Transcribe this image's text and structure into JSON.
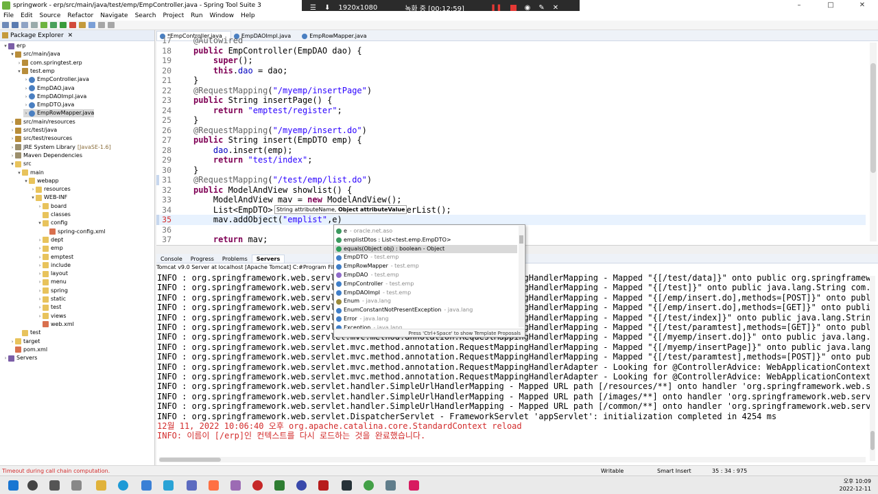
{
  "window": {
    "title": "springwork - erp/src/main/java/test/emp/EmpController.java - Spring Tool Suite 3",
    "controls": [
      "–",
      "□",
      "✕"
    ]
  },
  "recorder": {
    "resolution": "1920x1080",
    "status": "녹화 중 [00:12:59]"
  },
  "menu": [
    "File",
    "Edit",
    "Source",
    "Refactor",
    "Navigate",
    "Search",
    "Project",
    "Run",
    "Window",
    "Help"
  ],
  "package_explorer": {
    "tab": "Package Explorer",
    "items": [
      {
        "label": "erp",
        "indent": 0,
        "icon": "project-icon",
        "tw": "▾"
      },
      {
        "label": "src/main/java",
        "indent": 1,
        "icon": "package-icon",
        "tw": "▾"
      },
      {
        "label": "com.springtest.erp",
        "indent": 2,
        "icon": "package-icon",
        "tw": "›"
      },
      {
        "label": "test.emp",
        "indent": 2,
        "icon": "package-icon",
        "tw": "▾"
      },
      {
        "label": "EmpController.java",
        "indent": 3,
        "icon": "java-file-icon",
        "tw": "›"
      },
      {
        "label": "EmpDAO.java",
        "indent": 3,
        "icon": "java-file-icon",
        "tw": "›"
      },
      {
        "label": "EmpDAOImpl.java",
        "indent": 3,
        "icon": "java-file-icon",
        "tw": "›"
      },
      {
        "label": "EmpDTO.java",
        "indent": 3,
        "icon": "java-file-icon",
        "tw": "›"
      },
      {
        "label": "EmpRowMapper.java",
        "indent": 3,
        "icon": "java-file-icon",
        "tw": "›",
        "selected": true
      },
      {
        "label": "src/main/resources",
        "indent": 1,
        "icon": "package-icon",
        "tw": "›"
      },
      {
        "label": "src/test/java",
        "indent": 1,
        "icon": "package-icon",
        "tw": "›"
      },
      {
        "label": "src/test/resources",
        "indent": 1,
        "icon": "package-icon",
        "tw": "›"
      },
      {
        "label": "JRE System Library",
        "suffix": "[JavaSE-1.6]",
        "indent": 1,
        "icon": "library-icon",
        "tw": "›"
      },
      {
        "label": "Maven Dependencies",
        "indent": 1,
        "icon": "library-icon",
        "tw": "›"
      },
      {
        "label": "src",
        "indent": 1,
        "icon": "folder-icon",
        "tw": "▾"
      },
      {
        "label": "main",
        "indent": 2,
        "icon": "folder-icon",
        "tw": "▾"
      },
      {
        "label": "webapp",
        "indent": 3,
        "icon": "folder-icon",
        "tw": "▾"
      },
      {
        "label": "resources",
        "indent": 4,
        "icon": "folder-icon",
        "tw": "›"
      },
      {
        "label": "WEB-INF",
        "indent": 4,
        "icon": "folder-icon",
        "tw": "▾"
      },
      {
        "label": "board",
        "indent": 5,
        "icon": "folder-icon",
        "tw": "›"
      },
      {
        "label": "classes",
        "indent": 5,
        "icon": "folder-icon",
        "tw": ""
      },
      {
        "label": "config",
        "indent": 5,
        "icon": "folder-icon",
        "tw": "▾"
      },
      {
        "label": "spring-config.xml",
        "indent": 6,
        "icon": "xml-file-icon",
        "tw": ""
      },
      {
        "label": "dept",
        "indent": 5,
        "icon": "folder-icon",
        "tw": "›"
      },
      {
        "label": "emp",
        "indent": 5,
        "icon": "folder-icon",
        "tw": "›"
      },
      {
        "label": "emptest",
        "indent": 5,
        "icon": "folder-icon",
        "tw": "›"
      },
      {
        "label": "include",
        "indent": 5,
        "icon": "folder-icon",
        "tw": "›"
      },
      {
        "label": "layout",
        "indent": 5,
        "icon": "folder-icon",
        "tw": "›"
      },
      {
        "label": "menu",
        "indent": 5,
        "icon": "folder-icon",
        "tw": "›"
      },
      {
        "label": "spring",
        "indent": 5,
        "icon": "folder-icon",
        "tw": "›"
      },
      {
        "label": "static",
        "indent": 5,
        "icon": "folder-icon",
        "tw": "›"
      },
      {
        "label": "test",
        "indent": 5,
        "icon": "folder-icon",
        "tw": "›"
      },
      {
        "label": "views",
        "indent": 5,
        "icon": "folder-icon",
        "tw": "›"
      },
      {
        "label": "web.xml",
        "indent": 5,
        "icon": "xml-file-icon",
        "tw": ""
      },
      {
        "label": "test",
        "indent": 2,
        "icon": "folder-icon",
        "tw": ""
      },
      {
        "label": "target",
        "indent": 1,
        "icon": "folder-icon",
        "tw": "›"
      },
      {
        "label": "pom.xml",
        "indent": 1,
        "icon": "xml-file-icon",
        "tw": ""
      },
      {
        "label": "Servers",
        "indent": 0,
        "icon": "project-icon",
        "tw": "›"
      }
    ]
  },
  "editor": {
    "tabs": [
      {
        "label": "*EmpController.java",
        "active": true
      },
      {
        "label": "EmpDAOImpl.java",
        "active": false
      },
      {
        "label": "EmpRowMapper.java",
        "active": false
      }
    ],
    "lines": [
      {
        "n": "17",
        "html": "<span class=\"an\">@Autowired</span>"
      },
      {
        "n": "18",
        "html": "<span class=\"kw\">public</span> EmpController(EmpDAO dao) {"
      },
      {
        "n": "19",
        "html": "    <span class=\"kw\">super</span>();"
      },
      {
        "n": "20",
        "html": "    <span class=\"kw\">this</span>.<span class=\"fd\">dao</span> = dao;"
      },
      {
        "n": "21",
        "html": "}"
      },
      {
        "n": "22",
        "html": "<span class=\"an\">@RequestMapping</span>(<span class=\"st\">\"/myemp/insertPage\"</span>)"
      },
      {
        "n": "23",
        "html": "<span class=\"kw\">public</span> String insertPage() {"
      },
      {
        "n": "24",
        "html": "    <span class=\"kw\">return</span> <span class=\"st\">\"emptest/register\"</span>;"
      },
      {
        "n": "25",
        "html": "}"
      },
      {
        "n": "26",
        "html": "<span class=\"an\">@RequestMapping</span>(<span class=\"st\">\"/myemp/insert.do\"</span>)"
      },
      {
        "n": "27",
        "html": "<span class=\"kw\">public</span> String insert(EmpDTO emp) {"
      },
      {
        "n": "28",
        "html": "    <span class=\"fd\">dao</span>.insert(emp);"
      },
      {
        "n": "29",
        "html": "    <span class=\"kw\">return</span> <span class=\"st\">\"test/index\"</span>;"
      },
      {
        "n": "30",
        "html": "}"
      },
      {
        "n": "31",
        "html": "<span class=\"an\">@RequestMapping</span>(<span class=\"st\">\"/test/emp/list.do\"</span>)"
      },
      {
        "n": "32",
        "html": "<span class=\"kw\">public</span> ModelAndView showlist() {"
      },
      {
        "n": "33",
        "html": "    ModelAndView mav = <span class=\"kw\">new</span> ModelAndView();"
      },
      {
        "n": "34",
        "html": "    List&lt;EmpDTO&gt;                           erList();"
      },
      {
        "n": "35",
        "html": "    mav.addObject(<span class=\"st\">\"emplist\"</span>,e)"
      },
      {
        "n": "36",
        "html": ""
      },
      {
        "n": "37",
        "html": "    <span class=\"kw\">return</span> mav;"
      }
    ],
    "param_hint": {
      "p1": "String attributeName, ",
      "p2": "Object attributeValue"
    }
  },
  "assist": {
    "items": [
      {
        "icon": "field-icon",
        "name": "e",
        "qual": "- oracle.net.aso"
      },
      {
        "icon": "field-icon",
        "name": "emplistDtos : List<test.emp.EmpDTO>",
        "qual": ""
      },
      {
        "icon": "method-icon",
        "name": "equals(Object obj) : boolean - Object",
        "qual": "",
        "selected": true
      },
      {
        "icon": "class-icon",
        "name": "EmpDTO",
        "qual": "- test.emp"
      },
      {
        "icon": "class-icon",
        "name": "EmpRowMapper",
        "qual": "- test.emp"
      },
      {
        "icon": "interface-icon",
        "name": "EmpDAO",
        "qual": "- test.emp"
      },
      {
        "icon": "class-icon",
        "name": "EmpController",
        "qual": "- test.emp"
      },
      {
        "icon": "class-icon",
        "name": "EmpDAOImpl",
        "qual": "- test.emp"
      },
      {
        "icon": "enum-icon",
        "name": "Enum",
        "qual": "- java.lang"
      },
      {
        "icon": "class-icon",
        "name": "EnumConstantNotPresentException",
        "qual": "- java.lang"
      },
      {
        "icon": "class-icon",
        "name": "Error",
        "qual": "- java.lang"
      },
      {
        "icon": "class-icon",
        "name": "Exception",
        "qual": "- java.lang"
      }
    ],
    "footer": "Press 'Ctrl+Space' to show Template Proposals"
  },
  "console": {
    "tabs": [
      {
        "label": "Console",
        "active": false
      },
      {
        "label": "Progress",
        "active": false
      },
      {
        "label": "Problems",
        "active": false
      },
      {
        "label": "Servers",
        "active": true
      }
    ],
    "header": "Tomcat v9.0 Server at localhost [Apache Tomcat] C:#Program Files#Java#jdk-11.0.12#bin#javaw.exe",
    "lines": [
      {
        "text": "INFO : org.springframework.web.servlet.mvc.method.annotation.RequestMappingHandlerMapping - Mapped \"{[/test/data]}\" onto public org.springframework.we",
        "red": false
      },
      {
        "text": "INFO : org.springframework.web.servlet.mvc.method.annotation.RequestMappingHandlerMapping - Mapped \"{[/test]}\" onto public java.lang.String com.spring",
        "red": false
      },
      {
        "text": "INFO : org.springframework.web.servlet.mvc.method.annotation.RequestMappingHandlerMapping - Mapped \"{[/emp/insert.do],methods=[POST]}\" onto public jav",
        "red": false
      },
      {
        "text": "INFO : org.springframework.web.servlet.mvc.method.annotation.RequestMappingHandlerMapping - Mapped \"{[/emp/insert.do],methods=[GET]}\" onto public jav",
        "red": false
      },
      {
        "text": "INFO : org.springframework.web.servlet.mvc.method.annotation.RequestMappingHandlerMapping - Mapped \"{[/test/index]}\" onto public java.lang.String test",
        "red": false
      },
      {
        "text": "INFO : org.springframework.web.servlet.mvc.method.annotation.RequestMappingHandlerMapping - Mapped \"{[/test/paramtest],methods=[GET]}\" onto public jav",
        "red": false
      },
      {
        "text": "INFO : org.springframework.web.servlet.mvc.method.annotation.RequestMappingHandlerMapping - Mapped \"{[/myemp/insert.do]}\" onto public java.lang.String",
        "red": false
      },
      {
        "text": "INFO : org.springframework.web.servlet.mvc.method.annotation.RequestMappingHandlerMapping - Mapped \"{[/myemp/insertPage]}\" onto public java.lang.Strin",
        "red": false
      },
      {
        "text": "INFO : org.springframework.web.servlet.mvc.method.annotation.RequestMappingHandlerMapping - Mapped \"{[/test/paramtest],methods=[POST]}\" onto public ja",
        "red": false
      },
      {
        "text": "INFO : org.springframework.web.servlet.mvc.method.annotation.RequestMappingHandlerAdapter - Looking for @ControllerAdvice: WebApplicationContext for n",
        "red": false
      },
      {
        "text": "INFO : org.springframework.web.servlet.mvc.method.annotation.RequestMappingHandlerAdapter - Looking for @ControllerAdvice: WebApplicationContext for n",
        "red": false
      },
      {
        "text": "INFO : org.springframework.web.servlet.handler.SimpleUrlHandlerMapping - Mapped URL path [/resources/**] onto handler 'org.springframework.web.servlet",
        "red": false
      },
      {
        "text": "INFO : org.springframework.web.servlet.handler.SimpleUrlHandlerMapping - Mapped URL path [/images/**] onto handler 'org.springframework.web.servlet.re",
        "red": false
      },
      {
        "text": "INFO : org.springframework.web.servlet.handler.SimpleUrlHandlerMapping - Mapped URL path [/common/**] onto handler 'org.springframework.web.servlet.re",
        "red": false
      },
      {
        "text": "INFO : org.springframework.web.servlet.DispatcherServlet - FrameworkServlet 'appServlet': initialization completed in 4254 ms",
        "red": false
      },
      {
        "text": "12월 11, 2022 10:06:40 오후 org.apache.catalina.core.StandardContext reload",
        "red": true
      },
      {
        "text": "INFO: 이름이 [/erp]인 컨텍스트를 다시 로드하는 것을 완료했습니다.",
        "red": true
      }
    ]
  },
  "status": {
    "error": "Timeout during call chain computation.",
    "writable": "Writable",
    "insert_mode": "Smart Insert",
    "position": "35 : 34 : 975"
  },
  "clock": {
    "time": "오후 10:09",
    "date": "2022-12-11"
  },
  "colors": {
    "keyword": "#7f0055",
    "string": "#2a00ff",
    "annotation": "#646464",
    "error": "#d22b2b"
  }
}
